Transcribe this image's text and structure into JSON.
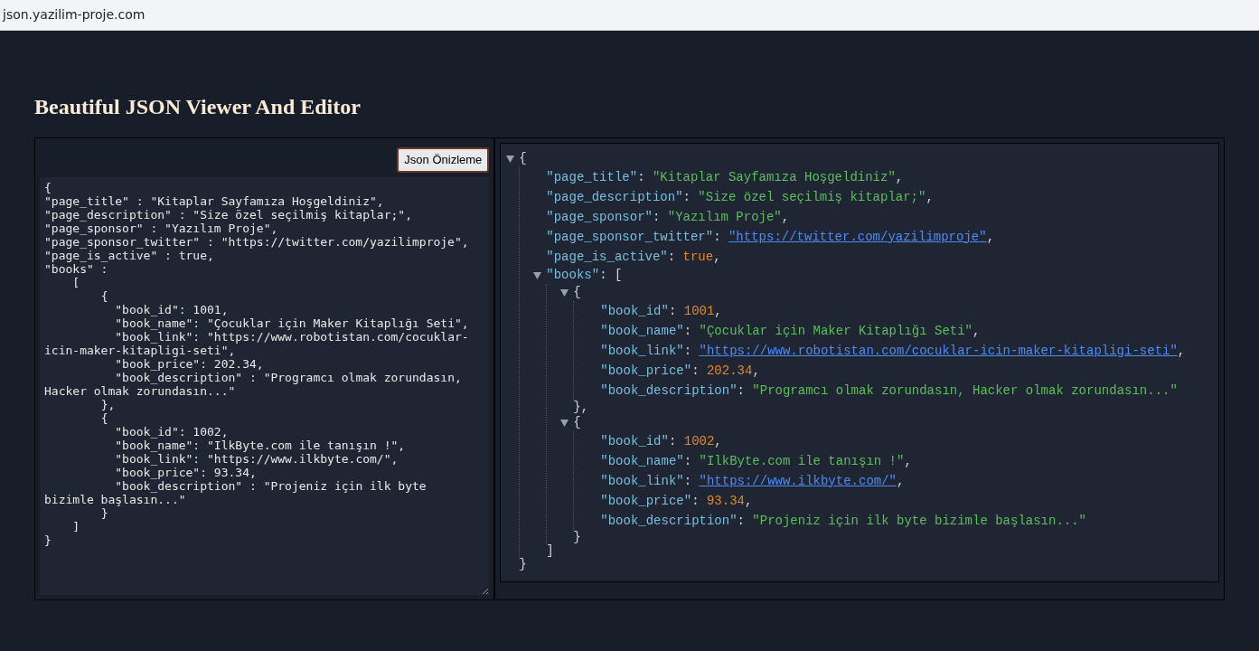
{
  "browser": {
    "url": "json.yazilim-proje.com"
  },
  "heading": "Beautiful JSON Viewer And Editor",
  "editor": {
    "button": "Json Önizleme",
    "text": "{\n\"page_title\" : \"Kitaplar Sayfamıza Hoşgeldiniz\",\n\"page_description\" : \"Size özel seçilmiş kitaplar;\",\n\"page_sponsor\" : \"Yazılım Proje\",\n\"page_sponsor_twitter\" : \"https://twitter.com/yazilimproje\",\n\"page_is_active\" : true,\n\"books\" :\n    [\n        {\n          \"book_id\": 1001,\n          \"book_name\": \"Çocuklar için Maker Kitaplığı Seti\",\n          \"book_link\": \"https://www.robotistan.com/cocuklar-icin-maker-kitapligi-seti\",\n          \"book_price\": 202.34,\n          \"book_description\" : \"Programcı olmak zorundasın, Hacker olmak zorundasın...\"\n        },\n        {\n          \"book_id\": 1002,\n          \"book_name\": \"IlkByte.com ile tanışın !\",\n          \"book_link\": \"https://www.ilkbyte.com/\",\n          \"book_price\": 93.34,\n          \"book_description\" : \"Projeniz için ilk byte bizimle başlasın...\"\n        }\n    ]\n}"
  },
  "viewer": {
    "root": {
      "kind": "object",
      "open": "{",
      "close": "}",
      "expanded": true,
      "children": [
        {
          "kind": "string",
          "key": "\"page_title\"",
          "sep": ": ",
          "value": "\"Kitaplar Sayfamıza Hoşgeldiniz\"",
          "end": ","
        },
        {
          "kind": "string",
          "key": "\"page_description\"",
          "sep": ": ",
          "value": "\"Size özel seçilmiş kitaplar;\"",
          "end": ","
        },
        {
          "kind": "string",
          "key": "\"page_sponsor\"",
          "sep": ": ",
          "value": "\"Yazılım Proje\"",
          "end": ","
        },
        {
          "kind": "link",
          "key": "\"page_sponsor_twitter\"",
          "sep": ": ",
          "value": "\"https://twitter.com/yazilimproje\"",
          "end": ","
        },
        {
          "kind": "boolean",
          "key": "\"page_is_active\"",
          "sep": ": ",
          "value": "true",
          "end": ","
        },
        {
          "kind": "object",
          "key": "\"books\"",
          "sep": ": ",
          "open": "[",
          "close": "]",
          "expanded": true,
          "children": [
            {
              "kind": "object",
              "open": "{",
              "close": "}",
              "end": ",",
              "expanded": true,
              "children": [
                {
                  "kind": "number",
                  "key": "\"book_id\"",
                  "sep": ": ",
                  "value": "1001",
                  "end": ","
                },
                {
                  "kind": "string",
                  "key": "\"book_name\"",
                  "sep": ": ",
                  "value": "\"Çocuklar için Maker Kitaplığı Seti\"",
                  "end": ","
                },
                {
                  "kind": "link",
                  "key": "\"book_link\"",
                  "sep": ": ",
                  "value": "\"https://www.robotistan.com/cocuklar-icin-maker-kitapligi-seti\"",
                  "end": ","
                },
                {
                  "kind": "number",
                  "key": "\"book_price\"",
                  "sep": ": ",
                  "value": "202.34",
                  "end": ","
                },
                {
                  "kind": "string",
                  "key": "\"book_description\"",
                  "sep": ": ",
                  "value": "\"Programcı olmak zorundasın, Hacker olmak zorundasın...\""
                }
              ]
            },
            {
              "kind": "object",
              "open": "{",
              "close": "}",
              "expanded": true,
              "children": [
                {
                  "kind": "number",
                  "key": "\"book_id\"",
                  "sep": ": ",
                  "value": "1002",
                  "end": ","
                },
                {
                  "kind": "string",
                  "key": "\"book_name\"",
                  "sep": ": ",
                  "value": "\"IlkByte.com ile tanışın !\"",
                  "end": ","
                },
                {
                  "kind": "link",
                  "key": "\"book_link\"",
                  "sep": ": ",
                  "value": "\"https://www.ilkbyte.com/\"",
                  "end": ","
                },
                {
                  "kind": "number",
                  "key": "\"book_price\"",
                  "sep": ": ",
                  "value": "93.34",
                  "end": ","
                },
                {
                  "kind": "string",
                  "key": "\"book_description\"",
                  "sep": ": ",
                  "value": "\"Projeniz için ilk byte bizimle başlasın...\""
                }
              ]
            }
          ]
        }
      ]
    }
  }
}
